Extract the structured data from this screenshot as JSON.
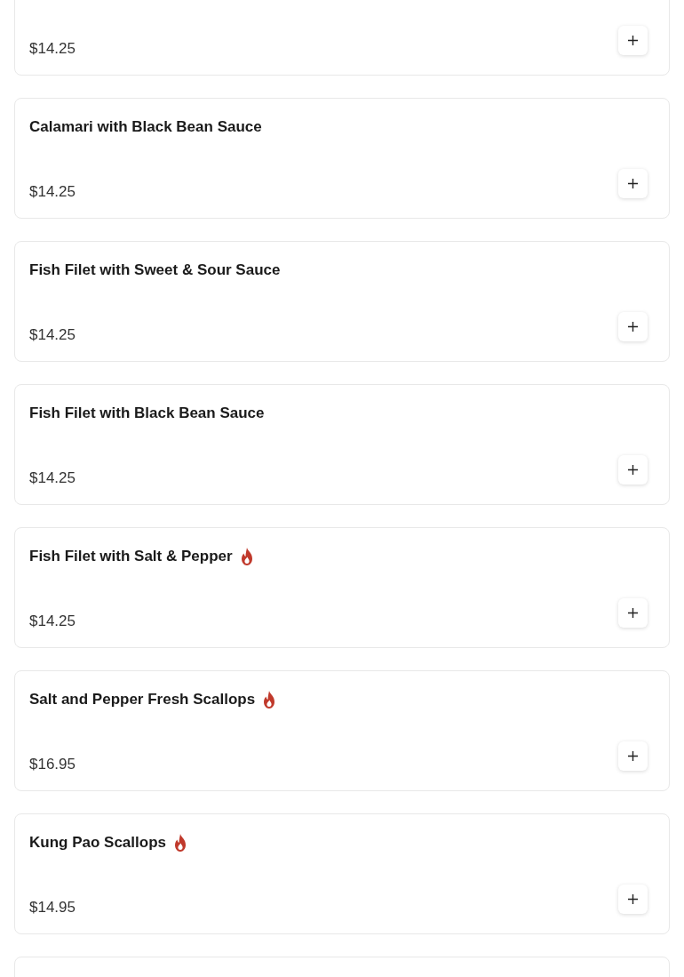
{
  "menu_items": [
    {
      "price": "$14.25"
    },
    {
      "name": "Calamari with Black Bean Sauce",
      "spicy": false,
      "price": "$14.25"
    },
    {
      "name": "Fish Filet with Sweet & Sour Sauce",
      "spicy": false,
      "price": "$14.25"
    },
    {
      "name": "Fish Filet with Black Bean Sauce",
      "spicy": false,
      "price": "$14.25"
    },
    {
      "name": "Fish Filet with Salt & Pepper",
      "spicy": true,
      "price": "$14.25"
    },
    {
      "name": "Salt and Pepper Fresh Scallops",
      "spicy": true,
      "price": "$16.95"
    },
    {
      "name": "Kung Pao Scallops",
      "spicy": true,
      "price": "$14.95"
    }
  ]
}
